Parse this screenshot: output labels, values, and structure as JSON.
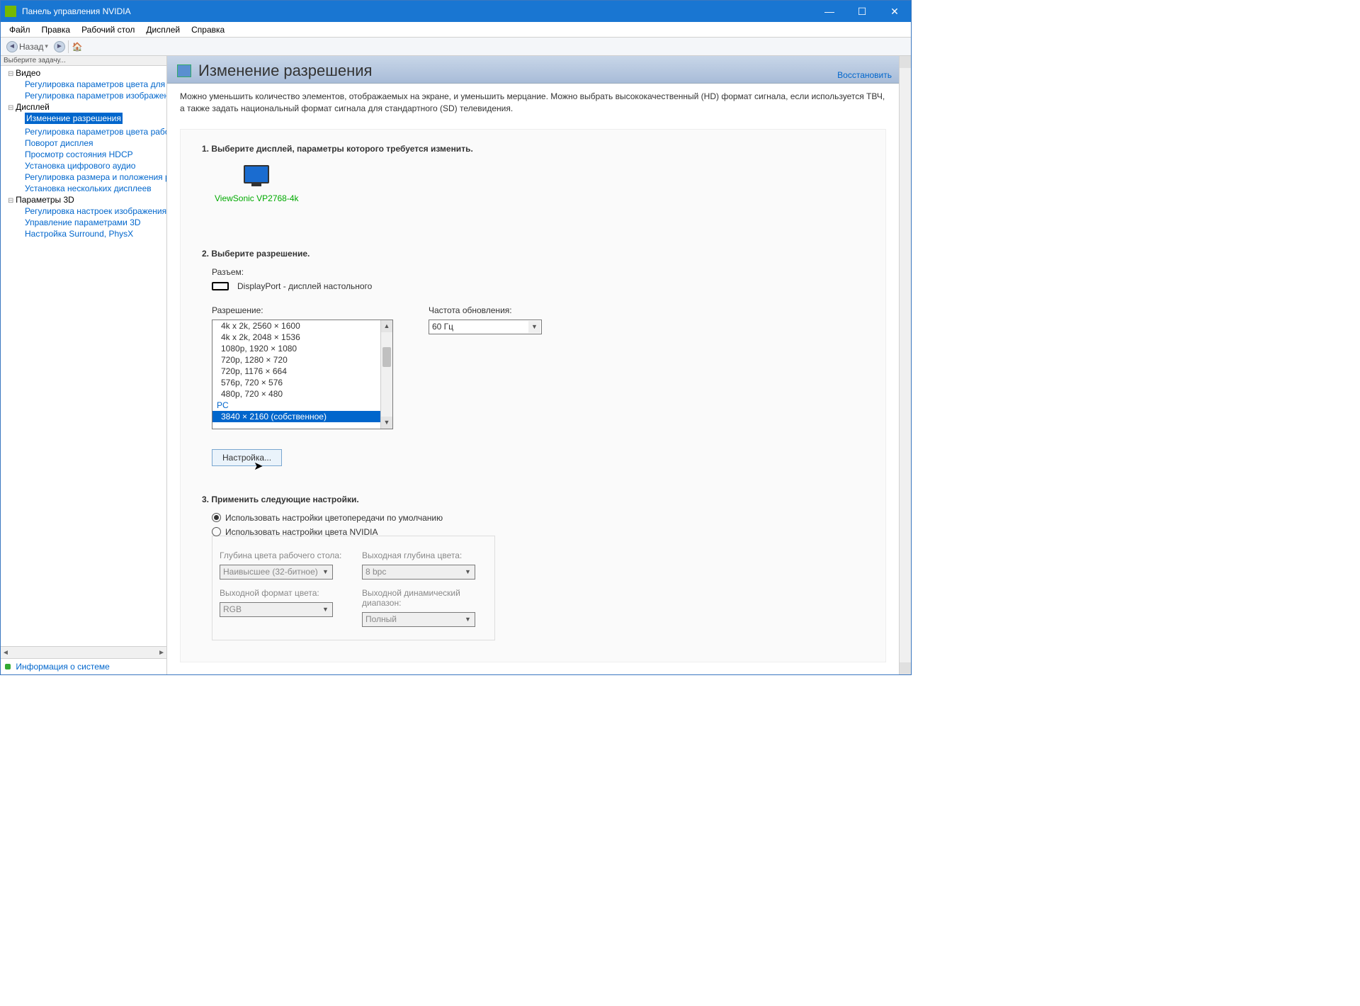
{
  "titlebar": {
    "title": "Панель управления NVIDIA"
  },
  "menubar": [
    "Файл",
    "Правка",
    "Рабочий стол",
    "Дисплей",
    "Справка"
  ],
  "toolbar": {
    "back_label": "Назад"
  },
  "sidebar": {
    "header": "Выберите задачу...",
    "groups": [
      {
        "label": "Видео",
        "items": [
          "Регулировка параметров цвета для видео",
          "Регулировка параметров изображения"
        ]
      },
      {
        "label": "Дисплей",
        "items": [
          "Изменение разрешения",
          "Регулировка параметров цвета рабочего",
          "Поворот дисплея",
          "Просмотр состояния HDCP",
          "Установка цифрового аудио",
          "Регулировка размера и положения рабочего",
          "Установка нескольких дисплеев"
        ],
        "selected_index": 0
      },
      {
        "label": "Параметры 3D",
        "items": [
          "Регулировка настроек изображения с просмотром",
          "Управление параметрами 3D",
          "Настройка Surround, PhysX"
        ]
      }
    ],
    "footer_link": "Информация о системе"
  },
  "page": {
    "title": "Изменение разрешения",
    "restore": "Восстановить",
    "intro": "Можно уменьшить количество элементов, отображаемых на экране, и уменьшить мерцание. Можно выбрать высококачественный (HD) формат сигнала, если используется ТВЧ, а также задать национальный формат сигнала для стандартного (SD) телевидения.",
    "step1": {
      "heading": "1. Выберите дисплей, параметры которого требуется изменить.",
      "monitor": "ViewSonic VP2768-4k"
    },
    "step2": {
      "heading": "2. Выберите разрешение.",
      "connector_label": "Разъем:",
      "connector_value": "DisplayPort - дисплей настольного",
      "resolution_label": "Разрешение:",
      "refresh_label": "Частота обновления:",
      "refresh_value": "60 Гц",
      "resolutions_visible": [
        "4k x 2k, 2560 × 1600",
        "4k x 2k, 2048 × 1536",
        "1080p, 1920 × 1080",
        "720p, 1280 × 720",
        "720p, 1176 × 664",
        "576p, 720 × 576",
        "480p, 720 × 480"
      ],
      "pc_group": "PC",
      "selected_resolution": "3840 × 2160 (собственное)",
      "customize_btn": "Настройка..."
    },
    "step3": {
      "heading": "3. Применить следующие настройки.",
      "radio_default": "Использовать настройки цветопередачи по умолчанию",
      "radio_nvidia": "Использовать настройки цвета NVIDIA",
      "depth_label": "Глубина цвета рабочего стола:",
      "depth_value": "Наивысшее (32-битное)",
      "out_depth_label": "Выходная глубина цвета:",
      "out_depth_value": "8 bpc",
      "out_format_label": "Выходной формат цвета:",
      "out_format_value": "RGB",
      "out_range_label": "Выходной динамический диапазон:",
      "out_range_value": "Полный"
    }
  }
}
